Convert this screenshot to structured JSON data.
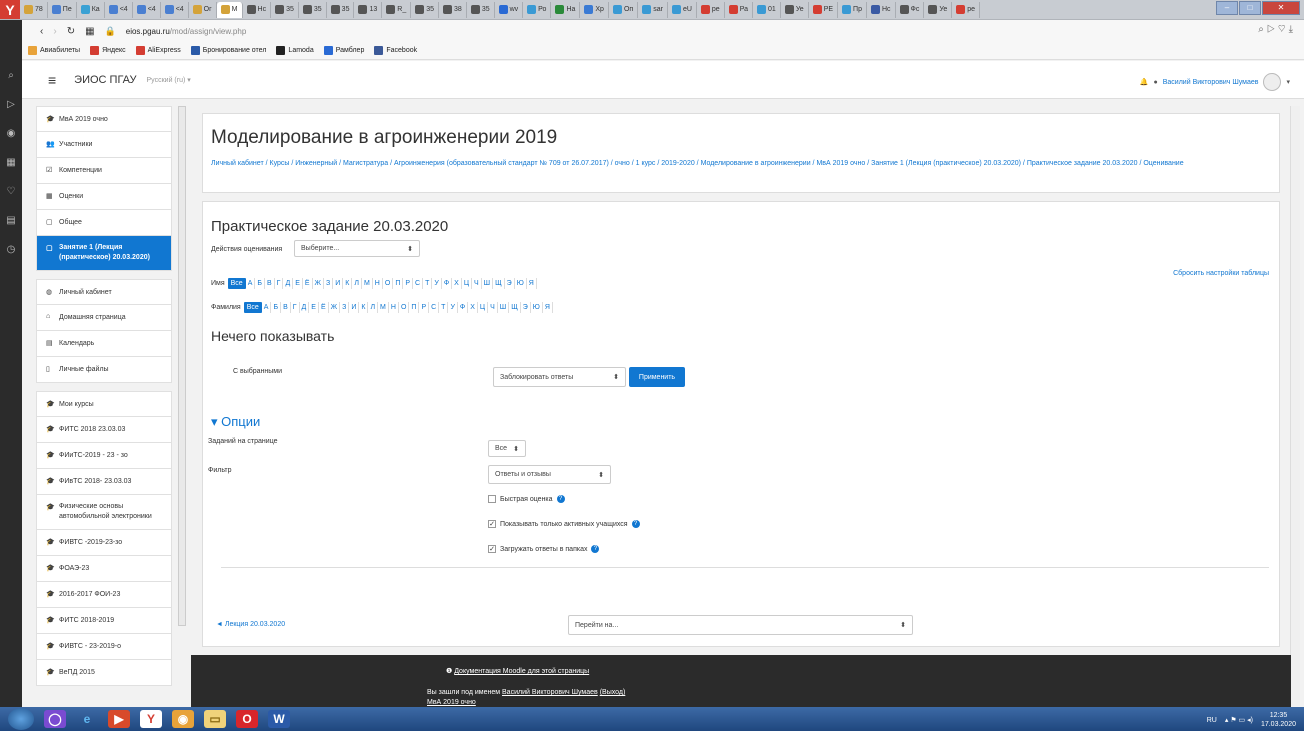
{
  "browser": {
    "tabs": [
      "78",
      "Пе",
      "Ка",
      "<4",
      "<4",
      "<4",
      "Ог",
      "М",
      "Нс",
      "35",
      "35",
      "35",
      "13",
      "R_",
      "35",
      "38",
      "35",
      "wv",
      "Ро",
      "На",
      "Хр",
      "Оп",
      "sar",
      "eU",
      "ре",
      "Ра",
      "01",
      "Уе",
      "РЕ",
      "Пр",
      "Нс",
      "Фс",
      "Уе",
      "ре"
    ],
    "active_tab_label": "М",
    "url_host": "eios.pgau.ru",
    "url_path": "/mod/assign/view.php",
    "bookmarks": [
      "Авиабилеты",
      "Яндекс",
      "AliExpress",
      "Бронирование отел",
      "Lamoda",
      "Рамблер",
      "Facebook"
    ]
  },
  "navbar": {
    "brand": "ЭИОС ПГАУ",
    "language": "Русский (ru) ▾",
    "user_name": "Василий Викторович Шумаев"
  },
  "drawer": {
    "items": [
      {
        "label": "МвА 2019 очно",
        "icon": "graduation-cap-icon"
      },
      {
        "label": "Участники",
        "icon": "users-icon"
      },
      {
        "label": "Компетенции",
        "icon": "checkbox-icon"
      },
      {
        "label": "Оценки",
        "icon": "table-icon"
      },
      {
        "label": "Общее",
        "icon": "folder-icon"
      },
      {
        "label": "Занятие 1 (Лекция (практическое) 20.03.2020)",
        "icon": "folder-icon",
        "active": true
      },
      {
        "label": "Личный кабинет",
        "icon": "dashboard-icon"
      },
      {
        "label": "Домашняя страница",
        "icon": "home-icon"
      },
      {
        "label": "Календарь",
        "icon": "calendar-icon"
      },
      {
        "label": "Личные файлы",
        "icon": "file-icon"
      },
      {
        "label": "Мои курсы",
        "icon": "graduation-cap-icon"
      },
      {
        "label": "ФИТС 2018 23.03.03",
        "icon": "graduation-cap-icon"
      },
      {
        "label": "ФИиТС-2019 - 23 - зо",
        "icon": "graduation-cap-icon"
      },
      {
        "label": "ФИвТС 2018- 23.03.03",
        "icon": "graduation-cap-icon"
      },
      {
        "label": "Физические основы автомобильной электроники",
        "icon": "graduation-cap-icon"
      },
      {
        "label": "ФИВТС -2019-23-зо",
        "icon": "graduation-cap-icon"
      },
      {
        "label": "ФОАЭ-23",
        "icon": "graduation-cap-icon"
      },
      {
        "label": "2016-2017 ФОИ-23",
        "icon": "graduation-cap-icon"
      },
      {
        "label": "ФИТС 2018-2019",
        "icon": "graduation-cap-icon"
      },
      {
        "label": "ФИВТС - 23-2019-о",
        "icon": "graduation-cap-icon"
      },
      {
        "label": "ВеПД 2015",
        "icon": "graduation-cap-icon"
      }
    ]
  },
  "header": {
    "title": "Моделирование в агроинженерии 2019",
    "breadcrumb": "Личный кабинет / Курсы / Инженерный / Магистратура / Агроинженерия (образовательный стандарт № 709 от 26.07.2017) / очно / 1 курс / 2019-2020 / Моделирование в агроинженерии / МвА 2019 очно / Занятие 1 (Лекция (практическое) 20.03.2020) / Практическое задание 20.03.2020 / Оценивание"
  },
  "main": {
    "title": "Практическое задание 20.03.2020",
    "grading_actions_label": "Действия оценивания",
    "grading_actions_value": "Выберите...",
    "reset_table": "Сбросить настройки таблицы",
    "firstname_label": "Имя",
    "lastname_label": "Фамилия",
    "all_label": "Все",
    "letters": [
      "А",
      "Б",
      "В",
      "Г",
      "Д",
      "Е",
      "Ё",
      "Ж",
      "З",
      "И",
      "К",
      "Л",
      "М",
      "Н",
      "О",
      "П",
      "Р",
      "С",
      "Т",
      "У",
      "Ф",
      "Х",
      "Ц",
      "Ч",
      "Ш",
      "Щ",
      "Э",
      "Ю",
      "Я"
    ],
    "nothing": "Нечего показывать",
    "with_selected_label": "С выбранными",
    "with_selected_value": "Заблокировать ответы",
    "apply_button": "Применить",
    "options_heading": "▾ Опции",
    "per_page_label": "Заданий на странице",
    "per_page_value": "Все",
    "filter_label": "Фильтр",
    "filter_value": "Ответы и отзывы",
    "quick_grading": "Быстрая оценка",
    "quick_grading_checked": false,
    "only_active": "Показывать только активных учащихся",
    "only_active_checked": true,
    "download_folders": "Загружать ответы в папках",
    "download_folders_checked": true,
    "prev_link": "◄ Лекция 20.03.2020",
    "jump_value": "Перейти на..."
  },
  "footer": {
    "doc_link": "Документация Moodle для этой страницы",
    "logged_prefix": "Вы зашли под именем",
    "logged_user": "Василий Викторович Шумаев",
    "logout": "(Выход)",
    "course_link": "МвА 2019 очно"
  },
  "taskbar": {
    "lang": "RU",
    "time": "12:35",
    "date": "17.03.2020"
  }
}
